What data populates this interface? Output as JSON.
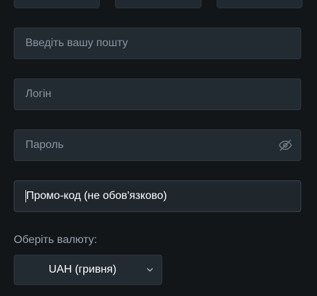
{
  "form": {
    "email": {
      "placeholder": "Введіть вашу пошту",
      "value": ""
    },
    "login": {
      "placeholder": "Логін",
      "value": ""
    },
    "password": {
      "placeholder": "Пароль",
      "value": "",
      "toggle_icon": "eye-off-icon"
    },
    "promo": {
      "placeholder": "Промо-код (не обов'язково)",
      "value": "",
      "focused": true
    },
    "currency": {
      "label": "Оберіть валюту:",
      "selected": "UAH (гривня)",
      "dropdown_icon": "chevron-down-icon"
    }
  },
  "colors": {
    "background": "#121619",
    "field_bg": "#232b32",
    "field_border": "#2e3840",
    "placeholder": "#8b95a0",
    "text": "#ffffff"
  }
}
